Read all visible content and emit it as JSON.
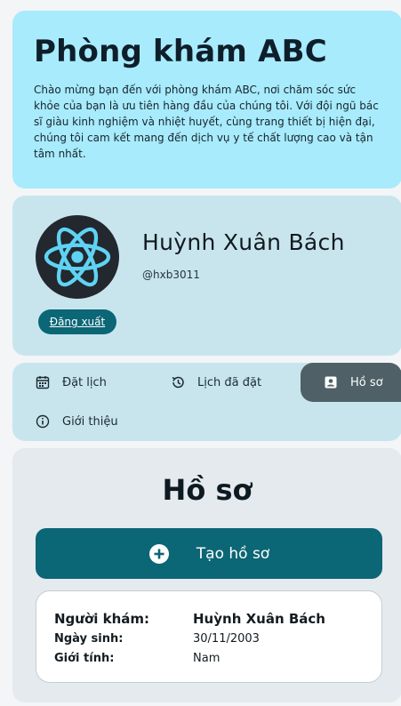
{
  "hero": {
    "title": "Phòng khám ABC",
    "description": "Chào mừng bạn đến với phòng khám ABC, nơi chăm sóc sức khỏe của bạn là ưu tiên hàng đầu của chúng tôi. Với đội ngũ bác sĩ giàu kinh nghiệm và nhiệt huyết, cùng trang thiết bị hiện đại, chúng tôi cam kết mang đến dịch vụ y tế chất lượng cao và tận tâm nhất."
  },
  "profile": {
    "name": "Huỳnh Xuân Bách",
    "handle": "@hxb3011",
    "logout_label": "Đăng xuất",
    "avatar_icon": "react-atom-icon"
  },
  "nav": {
    "items": [
      {
        "label": "Đặt lịch",
        "icon": "calendar-icon"
      },
      {
        "label": "Lịch đã đặt",
        "icon": "history-icon"
      },
      {
        "label": "Hồ sơ",
        "icon": "profile-card-icon",
        "active": true
      },
      {
        "label": "Giới thiệu",
        "icon": "info-icon"
      }
    ]
  },
  "main": {
    "title": "Hồ sơ",
    "create_label": "Tạo hồ sơ",
    "record": {
      "patient_key": "Người khám:",
      "patient_value": "Huỳnh Xuân Bách",
      "dob_key": "Ngày sinh:",
      "dob_value": "30/11/2003",
      "gender_key": "Giới tính:",
      "gender_value": "Nam"
    }
  },
  "colors": {
    "hero_bg": "#a8ebfc",
    "panel_bg": "#c8e5ee",
    "accent": "#0b6675",
    "active_tab": "#4f6066",
    "react_blue": "#5fd3f3"
  }
}
